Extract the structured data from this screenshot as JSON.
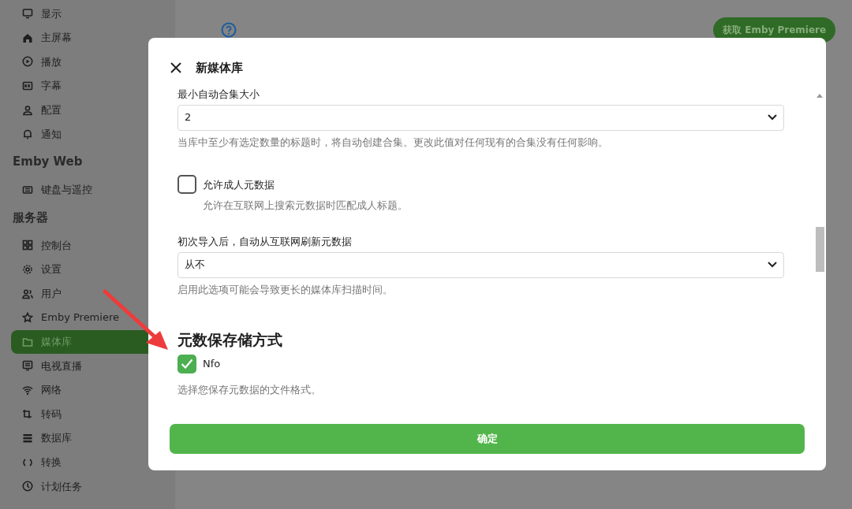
{
  "sidebar": {
    "sections": [
      {
        "items": [
          {
            "label": "显示",
            "selected": false
          },
          {
            "label": "主屏幕",
            "selected": false
          },
          {
            "label": "播放",
            "selected": false
          },
          {
            "label": "字幕",
            "selected": false
          },
          {
            "label": "配置",
            "selected": false
          },
          {
            "label": "通知",
            "selected": false
          }
        ]
      },
      {
        "title": "Emby Web",
        "items": [
          {
            "label": "键盘与遥控",
            "selected": false
          }
        ]
      },
      {
        "title": "服务器",
        "items": [
          {
            "label": "控制台",
            "selected": false
          },
          {
            "label": "设置",
            "selected": false
          },
          {
            "label": "用户",
            "selected": false
          },
          {
            "label": "Emby Premiere",
            "selected": false
          },
          {
            "label": "媒体库",
            "selected": true
          },
          {
            "label": "电视直播",
            "selected": false
          },
          {
            "label": "网络",
            "selected": false
          },
          {
            "label": "转码",
            "selected": false
          },
          {
            "label": "数据库",
            "selected": false
          },
          {
            "label": "转换",
            "selected": false
          },
          {
            "label": "计划任务",
            "selected": false
          }
        ]
      }
    ]
  },
  "header": {
    "premiere_button": "获取 Emby Premiere"
  },
  "dialog": {
    "title": "新媒体库",
    "fields": [
      {
        "kind": "select",
        "label": "最小自动合集大小",
        "value": "2",
        "help": "当库中至少有选定数量的标题时，将自动创建合集。更改此值对任何现有的合集没有任何影响。"
      },
      {
        "kind": "checkbox",
        "label": "允许成人元数据",
        "checked": false,
        "help": "允许在互联网上搜索元数据时匹配成人标题。"
      },
      {
        "kind": "select",
        "label": "初次导入后，自动从互联网刷新元数据",
        "value": "从不",
        "help": "启用此选项可能会导致更长的媒体库扫描时间。"
      },
      {
        "kind": "heading",
        "label": "元数保存储方式"
      },
      {
        "kind": "checkbox",
        "label": "Nfo",
        "checked": true,
        "help": "选择您保存元数据的文件格式。"
      }
    ],
    "confirm_button": "确定"
  }
}
